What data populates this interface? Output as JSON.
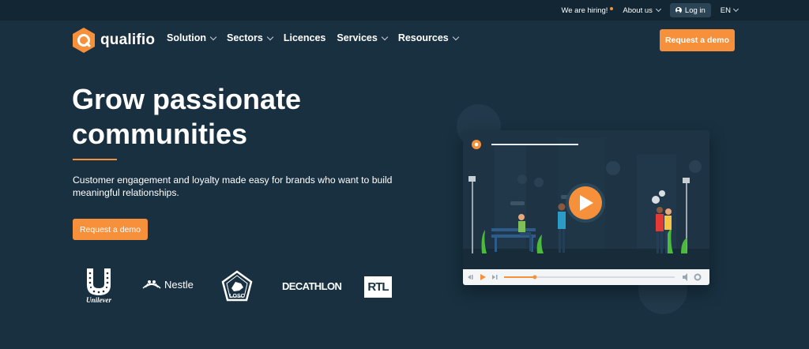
{
  "topbar": {
    "hiring": "We are hiring!",
    "about": "About us",
    "login": "Log in",
    "lang": "EN"
  },
  "header": {
    "logo_text": "qualifio",
    "nav": [
      {
        "label": "Solution",
        "has_menu": true
      },
      {
        "label": "Sectors",
        "has_menu": true
      },
      {
        "label": "Licences",
        "has_menu": false
      },
      {
        "label": "Services",
        "has_menu": true
      },
      {
        "label": "Resources",
        "has_menu": true
      }
    ],
    "cta": "Request a demo"
  },
  "hero": {
    "title": "Grow passionate communities",
    "subtitle": "Customer engagement and loyalty made easy for brands who want to build meaningful relationships.",
    "cta": "Request a demo"
  },
  "logos": {
    "unilever": "Unilever",
    "nestle": "Nestle",
    "losc": "LOSC",
    "decathlon": "DECATHLON",
    "rtl": "RTL"
  },
  "colors": {
    "background": "#183040",
    "topbar": "#122634",
    "accent": "#f7903a"
  },
  "video": {
    "progress_fraction": 0.18
  }
}
